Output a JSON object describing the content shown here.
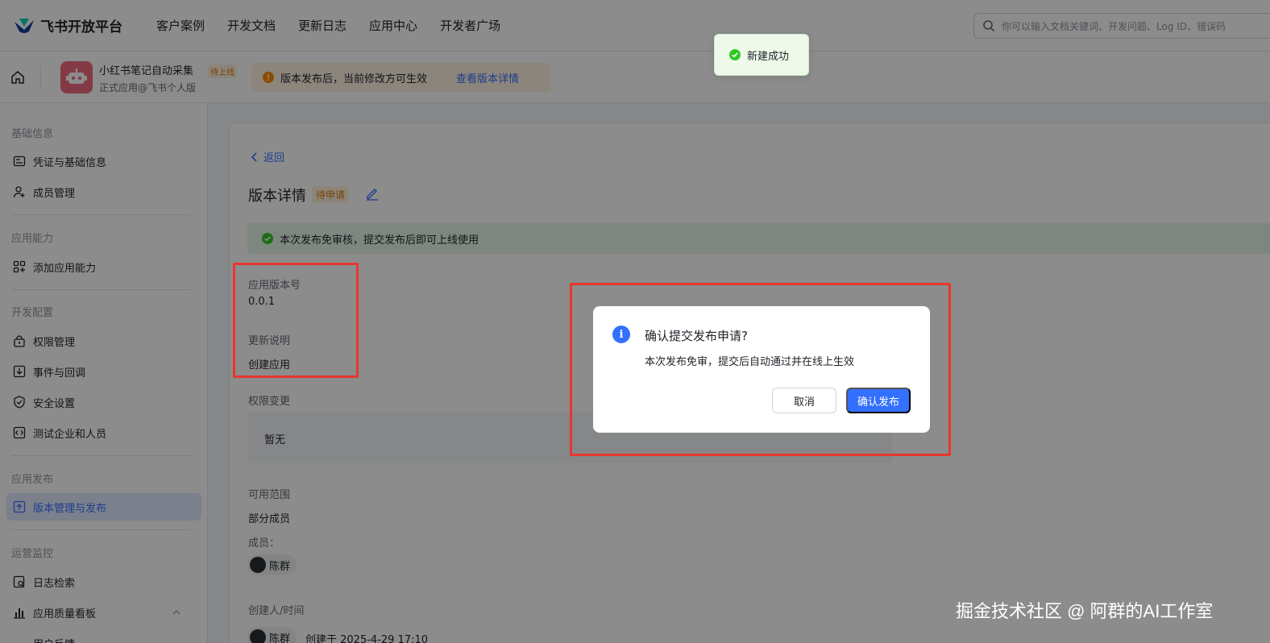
{
  "topnav": {
    "brand": "飞书开放平台",
    "links": [
      "客户案例",
      "开发文档",
      "更新日志",
      "应用中心",
      "开发者广场"
    ],
    "search_placeholder": "你可以输入文档关键词、开发问题、Log ID、错误码"
  },
  "appbar": {
    "app_name": "小红书笔记自动采集",
    "app_status": "待上线",
    "app_sub": "正式应用@飞书个人版",
    "notice_text": "版本发布后，当前修改方可生效",
    "notice_link": "查看版本详情"
  },
  "sidebar": {
    "groups": {
      "basic": "基础信息",
      "ability": "应用能力",
      "dev": "开发配置",
      "publish": "应用发布",
      "ops": "运营监控"
    },
    "items": {
      "credentials": "凭证与基础信息",
      "members": "成员管理",
      "add_ability": "添加应用能力",
      "permissions": "权限管理",
      "events": "事件与回调",
      "security": "安全设置",
      "test_enterprise": "测试企业和人员",
      "version_publish": "版本管理与发布",
      "log_search": "日志检索",
      "quality_board": "应用质量看板",
      "cut_item": "用户反馈"
    }
  },
  "main": {
    "back": "返回",
    "title": "版本详情",
    "title_badge": "待申请",
    "success_text": "本次发布免审核，提交发布后即可上线使用",
    "version_label": "应用版本号",
    "version_value": "0.0.1",
    "notes_label": "更新说明",
    "notes_value": "创建应用",
    "perm_label": "权限变更",
    "perm_value": "暂无",
    "scope_label": "可用范围",
    "scope_value": "部分成员",
    "members_label": "成员：",
    "member_name": "陈群",
    "creator_label": "创建人/时间",
    "creator_name": "陈群",
    "created_at": "创建于 2025-4-29 17:10"
  },
  "dialog": {
    "title": "确认提交发布申请?",
    "body": "本次发布免审，提交后自动通过并在线上生效",
    "cancel": "取消",
    "confirm": "确认发布",
    "info_glyph": "i"
  },
  "toast": {
    "text": "新建成功"
  },
  "watermark": "掘金技术社区 @ 阿群的AI工作室",
  "colors": {
    "primary": "#3370ff",
    "warning": "#de7802",
    "success": "#34c724",
    "highlight": "#e8372c"
  }
}
